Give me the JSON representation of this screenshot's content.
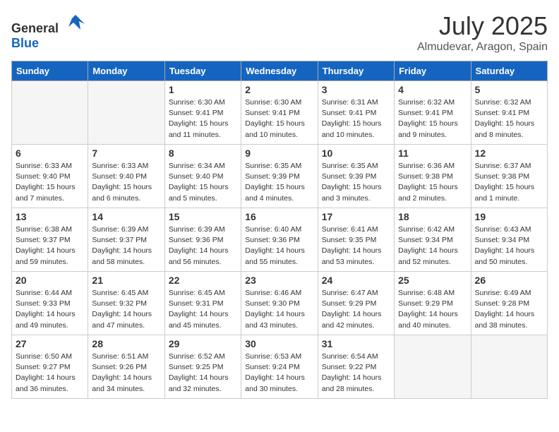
{
  "logo": {
    "general": "General",
    "blue": "Blue"
  },
  "title": {
    "month": "July 2025",
    "location": "Almudevar, Aragon, Spain"
  },
  "weekdays": [
    "Sunday",
    "Monday",
    "Tuesday",
    "Wednesday",
    "Thursday",
    "Friday",
    "Saturday"
  ],
  "weeks": [
    [
      {
        "day": "",
        "sunrise": "",
        "sunset": "",
        "daylight": ""
      },
      {
        "day": "",
        "sunrise": "",
        "sunset": "",
        "daylight": ""
      },
      {
        "day": "1",
        "sunrise": "Sunrise: 6:30 AM",
        "sunset": "Sunset: 9:41 PM",
        "daylight": "Daylight: 15 hours and 11 minutes."
      },
      {
        "day": "2",
        "sunrise": "Sunrise: 6:30 AM",
        "sunset": "Sunset: 9:41 PM",
        "daylight": "Daylight: 15 hours and 10 minutes."
      },
      {
        "day": "3",
        "sunrise": "Sunrise: 6:31 AM",
        "sunset": "Sunset: 9:41 PM",
        "daylight": "Daylight: 15 hours and 10 minutes."
      },
      {
        "day": "4",
        "sunrise": "Sunrise: 6:32 AM",
        "sunset": "Sunset: 9:41 PM",
        "daylight": "Daylight: 15 hours and 9 minutes."
      },
      {
        "day": "5",
        "sunrise": "Sunrise: 6:32 AM",
        "sunset": "Sunset: 9:41 PM",
        "daylight": "Daylight: 15 hours and 8 minutes."
      }
    ],
    [
      {
        "day": "6",
        "sunrise": "Sunrise: 6:33 AM",
        "sunset": "Sunset: 9:40 PM",
        "daylight": "Daylight: 15 hours and 7 minutes."
      },
      {
        "day": "7",
        "sunrise": "Sunrise: 6:33 AM",
        "sunset": "Sunset: 9:40 PM",
        "daylight": "Daylight: 15 hours and 6 minutes."
      },
      {
        "day": "8",
        "sunrise": "Sunrise: 6:34 AM",
        "sunset": "Sunset: 9:40 PM",
        "daylight": "Daylight: 15 hours and 5 minutes."
      },
      {
        "day": "9",
        "sunrise": "Sunrise: 6:35 AM",
        "sunset": "Sunset: 9:39 PM",
        "daylight": "Daylight: 15 hours and 4 minutes."
      },
      {
        "day": "10",
        "sunrise": "Sunrise: 6:35 AM",
        "sunset": "Sunset: 9:39 PM",
        "daylight": "Daylight: 15 hours and 3 minutes."
      },
      {
        "day": "11",
        "sunrise": "Sunrise: 6:36 AM",
        "sunset": "Sunset: 9:38 PM",
        "daylight": "Daylight: 15 hours and 2 minutes."
      },
      {
        "day": "12",
        "sunrise": "Sunrise: 6:37 AM",
        "sunset": "Sunset: 9:38 PM",
        "daylight": "Daylight: 15 hours and 1 minute."
      }
    ],
    [
      {
        "day": "13",
        "sunrise": "Sunrise: 6:38 AM",
        "sunset": "Sunset: 9:37 PM",
        "daylight": "Daylight: 14 hours and 59 minutes."
      },
      {
        "day": "14",
        "sunrise": "Sunrise: 6:39 AM",
        "sunset": "Sunset: 9:37 PM",
        "daylight": "Daylight: 14 hours and 58 minutes."
      },
      {
        "day": "15",
        "sunrise": "Sunrise: 6:39 AM",
        "sunset": "Sunset: 9:36 PM",
        "daylight": "Daylight: 14 hours and 56 minutes."
      },
      {
        "day": "16",
        "sunrise": "Sunrise: 6:40 AM",
        "sunset": "Sunset: 9:36 PM",
        "daylight": "Daylight: 14 hours and 55 minutes."
      },
      {
        "day": "17",
        "sunrise": "Sunrise: 6:41 AM",
        "sunset": "Sunset: 9:35 PM",
        "daylight": "Daylight: 14 hours and 53 minutes."
      },
      {
        "day": "18",
        "sunrise": "Sunrise: 6:42 AM",
        "sunset": "Sunset: 9:34 PM",
        "daylight": "Daylight: 14 hours and 52 minutes."
      },
      {
        "day": "19",
        "sunrise": "Sunrise: 6:43 AM",
        "sunset": "Sunset: 9:34 PM",
        "daylight": "Daylight: 14 hours and 50 minutes."
      }
    ],
    [
      {
        "day": "20",
        "sunrise": "Sunrise: 6:44 AM",
        "sunset": "Sunset: 9:33 PM",
        "daylight": "Daylight: 14 hours and 49 minutes."
      },
      {
        "day": "21",
        "sunrise": "Sunrise: 6:45 AM",
        "sunset": "Sunset: 9:32 PM",
        "daylight": "Daylight: 14 hours and 47 minutes."
      },
      {
        "day": "22",
        "sunrise": "Sunrise: 6:45 AM",
        "sunset": "Sunset: 9:31 PM",
        "daylight": "Daylight: 14 hours and 45 minutes."
      },
      {
        "day": "23",
        "sunrise": "Sunrise: 6:46 AM",
        "sunset": "Sunset: 9:30 PM",
        "daylight": "Daylight: 14 hours and 43 minutes."
      },
      {
        "day": "24",
        "sunrise": "Sunrise: 6:47 AM",
        "sunset": "Sunset: 9:29 PM",
        "daylight": "Daylight: 14 hours and 42 minutes."
      },
      {
        "day": "25",
        "sunrise": "Sunrise: 6:48 AM",
        "sunset": "Sunset: 9:29 PM",
        "daylight": "Daylight: 14 hours and 40 minutes."
      },
      {
        "day": "26",
        "sunrise": "Sunrise: 6:49 AM",
        "sunset": "Sunset: 9:28 PM",
        "daylight": "Daylight: 14 hours and 38 minutes."
      }
    ],
    [
      {
        "day": "27",
        "sunrise": "Sunrise: 6:50 AM",
        "sunset": "Sunset: 9:27 PM",
        "daylight": "Daylight: 14 hours and 36 minutes."
      },
      {
        "day": "28",
        "sunrise": "Sunrise: 6:51 AM",
        "sunset": "Sunset: 9:26 PM",
        "daylight": "Daylight: 14 hours and 34 minutes."
      },
      {
        "day": "29",
        "sunrise": "Sunrise: 6:52 AM",
        "sunset": "Sunset: 9:25 PM",
        "daylight": "Daylight: 14 hours and 32 minutes."
      },
      {
        "day": "30",
        "sunrise": "Sunrise: 6:53 AM",
        "sunset": "Sunset: 9:24 PM",
        "daylight": "Daylight: 14 hours and 30 minutes."
      },
      {
        "day": "31",
        "sunrise": "Sunrise: 6:54 AM",
        "sunset": "Sunset: 9:22 PM",
        "daylight": "Daylight: 14 hours and 28 minutes."
      },
      {
        "day": "",
        "sunrise": "",
        "sunset": "",
        "daylight": ""
      },
      {
        "day": "",
        "sunrise": "",
        "sunset": "",
        "daylight": ""
      }
    ]
  ]
}
